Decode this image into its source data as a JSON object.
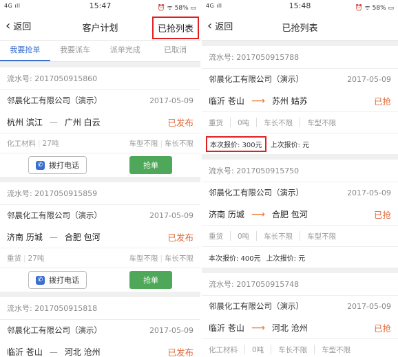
{
  "left": {
    "status": {
      "signal": "4G ıll",
      "time": "15:47",
      "right": "⏰ ᯤ 58% ▭"
    },
    "nav": {
      "back": "返回",
      "title": "客户计划",
      "right": "已抢列表"
    },
    "tabs": [
      "我要抢单",
      "我要派车",
      "派单完成",
      "已取消"
    ],
    "orders": [
      {
        "serial": "流水号: 2017050915860",
        "company": "邻晨化工有限公司（演示）",
        "date": "2017-05-09",
        "from": "杭州 滨江",
        "to": "广州 白云",
        "status": "已发布",
        "cargo": "化工材料",
        "weight": "27吨",
        "type": "车型不限",
        "length": "车长不限",
        "call": "拨打电话",
        "grab": "抢单"
      },
      {
        "serial": "流水号: 2017050915859",
        "company": "邻晨化工有限公司（演示）",
        "date": "2017-05-09",
        "from": "济南 历城",
        "to": "合肥 包河",
        "status": "已发布",
        "cargo": "重货",
        "weight": "27吨",
        "type": "车型不限",
        "length": "车长不限",
        "call": "拨打电话",
        "grab": "抢单"
      },
      {
        "serial": "流水号: 2017050915818",
        "company": "邻晨化工有限公司（演示）",
        "date": "2017-05-09",
        "from": "临沂 苍山",
        "to": "河北 沧州",
        "status": "已发布"
      }
    ]
  },
  "right": {
    "status": {
      "signal": "4G ıll",
      "time": "15:48",
      "right": "⏰ ᯤ 58% ▭"
    },
    "nav": {
      "back": "返回",
      "title": "已抢列表"
    },
    "orders": [
      {
        "serial": "流水号: 2017050915788",
        "company": "邻晨化工有限公司（演示）",
        "date": "2017-05-09",
        "from": "临沂 苍山",
        "to": "苏州 姑苏",
        "status": "已抢",
        "cargo": "重货",
        "weight": "0吨",
        "length": "车长不限",
        "type": "车型不限",
        "this_price": "本次报价: 300元",
        "last_price": "上次报价: 元"
      },
      {
        "serial": "流水号: 2017050915750",
        "company": "邻晨化工有限公司（演示）",
        "date": "2017-05-09",
        "from": "济南 历城",
        "to": "合肥 包河",
        "status": "已抢",
        "cargo": "重货",
        "weight": "0吨",
        "length": "车长不限",
        "type": "车型不限",
        "this_price": "本次报价: 400元",
        "last_price": "上次报价: 元"
      },
      {
        "serial": "流水号: 2017050915748",
        "company": "邻晨化工有限公司（演示）",
        "date": "2017-05-09",
        "from": "临沂 苍山",
        "to": "河北 沧州",
        "status": "已抢",
        "cargo": "化工材料",
        "weight": "0吨",
        "length": "车长不限",
        "type": "车型不限"
      }
    ]
  }
}
